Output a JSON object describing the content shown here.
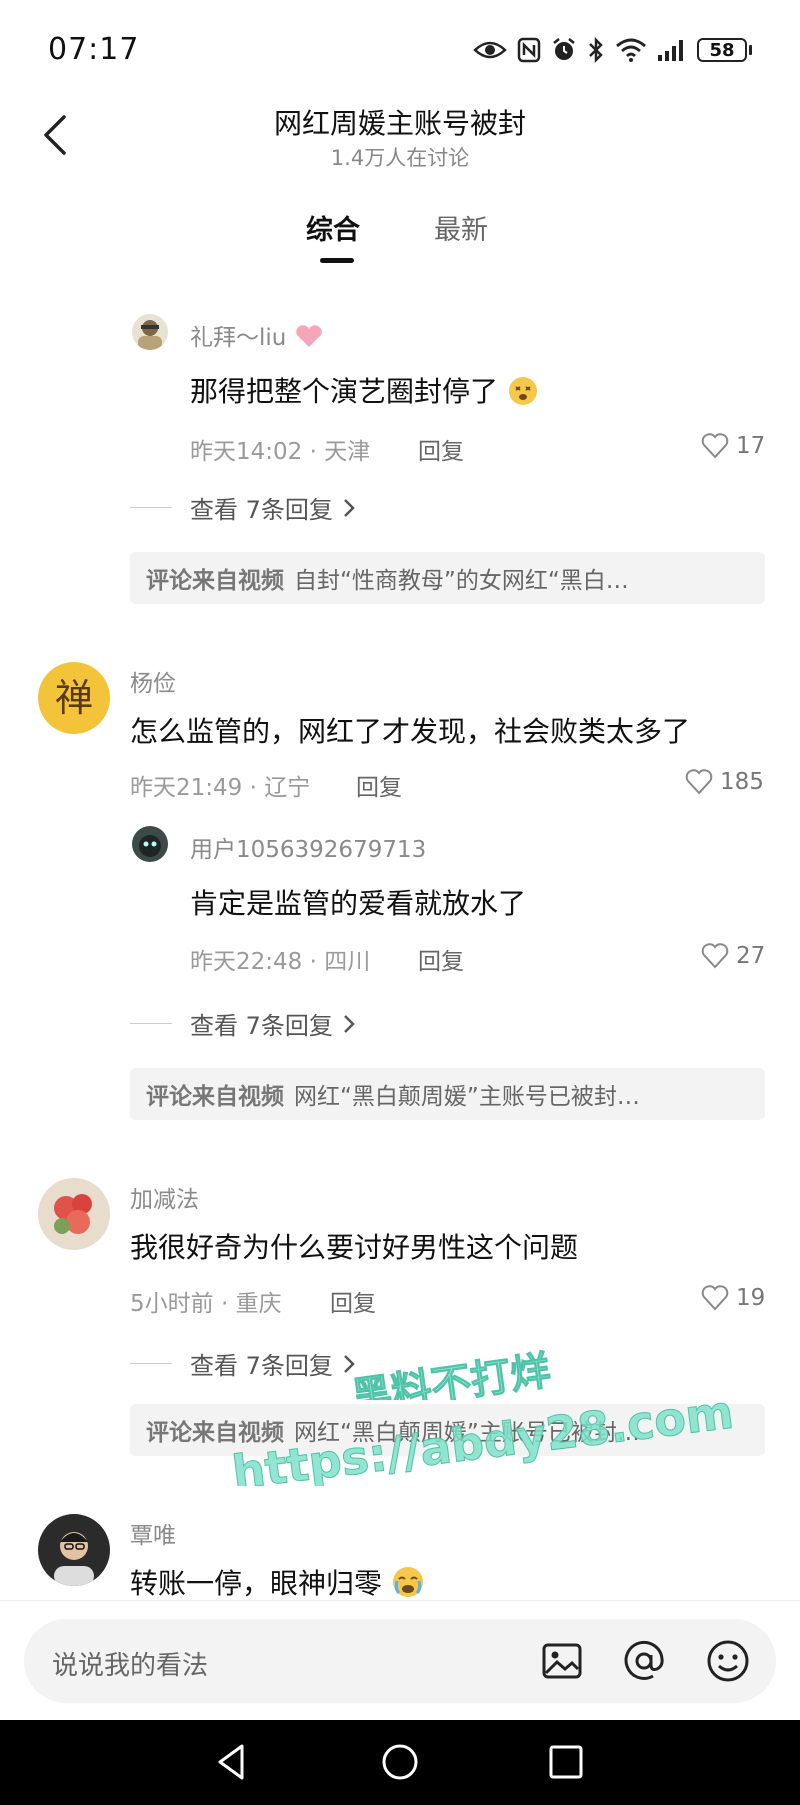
{
  "status_bar": {
    "time": "07:17",
    "battery": "58"
  },
  "header": {
    "title": "网红周媛主账号被封",
    "subtitle": "1.4万人在讨论"
  },
  "tabs": [
    {
      "label": "综合"
    },
    {
      "label": "最新"
    }
  ],
  "comments": [
    {
      "type": "reply",
      "name": "礼拜～liu",
      "text": "那得把整个演艺圈封停了",
      "time_location": "昨天14:02 · 天津",
      "reply_label": "回复",
      "likes": "17",
      "view_replies": "查看 7条回复",
      "source_prefix": "评论来自视频",
      "source_title": "自封“性商教母”的女网红“黑白…"
    },
    {
      "type": "top",
      "name": "杨俭",
      "avatar_char": "禅",
      "text": "怎么监管的，网红了才发现，社会败类太多了",
      "time_location": "昨天21:49 · 辽宁",
      "reply_label": "回复",
      "likes": "185"
    },
    {
      "type": "reply",
      "name": "用户1056392679713",
      "text": "肯定是监管的爱看就放水了",
      "time_location": "昨天22:48 · 四川",
      "reply_label": "回复",
      "likes": "27",
      "view_replies": "查看 7条回复",
      "source_prefix": "评论来自视频",
      "source_title": "网红“黑白颠周媛”主账号已被封…"
    },
    {
      "type": "top",
      "name": "加减法",
      "text": "我很好奇为什么要讨好男性这个问题",
      "time_location": "5小时前 · 重庆",
      "reply_label": "回复",
      "likes": "19",
      "view_replies": "查看 7条回复",
      "source_prefix": "评论来自视频",
      "source_title": "网红“黑白颠周媛”主账号已被封…"
    },
    {
      "type": "top",
      "name": "覃唯",
      "text": "转账一停，眼神归零"
    }
  ],
  "bottom_bar": {
    "placeholder": "说说我的看法"
  },
  "watermark": {
    "line1": "黑料不打烊",
    "line2": "https://abdy28.com"
  },
  "colors": {
    "accent": "#111111",
    "muted": "#9a9a9a",
    "watermark": "#7fe0c8"
  }
}
